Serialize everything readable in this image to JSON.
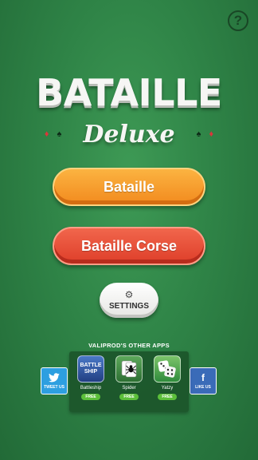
{
  "header": {
    "help_label": "?"
  },
  "logo": {
    "title": "BATAILLE",
    "subtitle": "Deluxe",
    "suits_left": [
      "♦",
      "♠"
    ],
    "suits_right": [
      "♠",
      "♦"
    ]
  },
  "menu": {
    "bataille_label": "Bataille",
    "corse_label": "Bataille Corse",
    "settings_label": "SETTINGS"
  },
  "other_apps": {
    "title": "VALIPROD'S OTHER APPS",
    "twitter_label": "TWEET US",
    "facebook_label": "LIKE US",
    "apps": [
      {
        "name": "Battleship",
        "badge": "FREE",
        "icon_text_1": "BATTLE",
        "icon_text_2": "SHIP"
      },
      {
        "name": "Spider",
        "badge": "FREE"
      },
      {
        "name": "Yatzy",
        "badge": "FREE"
      }
    ]
  },
  "colors": {
    "background": "#2f8447",
    "bataille_button": "#f6952a",
    "corse_button": "#e84d36",
    "twitter": "#2d9fe0",
    "facebook": "#3a6bb8",
    "free_badge": "#5cbf3a"
  },
  "icons": {
    "help": "question-icon",
    "settings": "gear-icon",
    "twitter": "twitter-bird-icon",
    "facebook": "facebook-f-icon"
  }
}
